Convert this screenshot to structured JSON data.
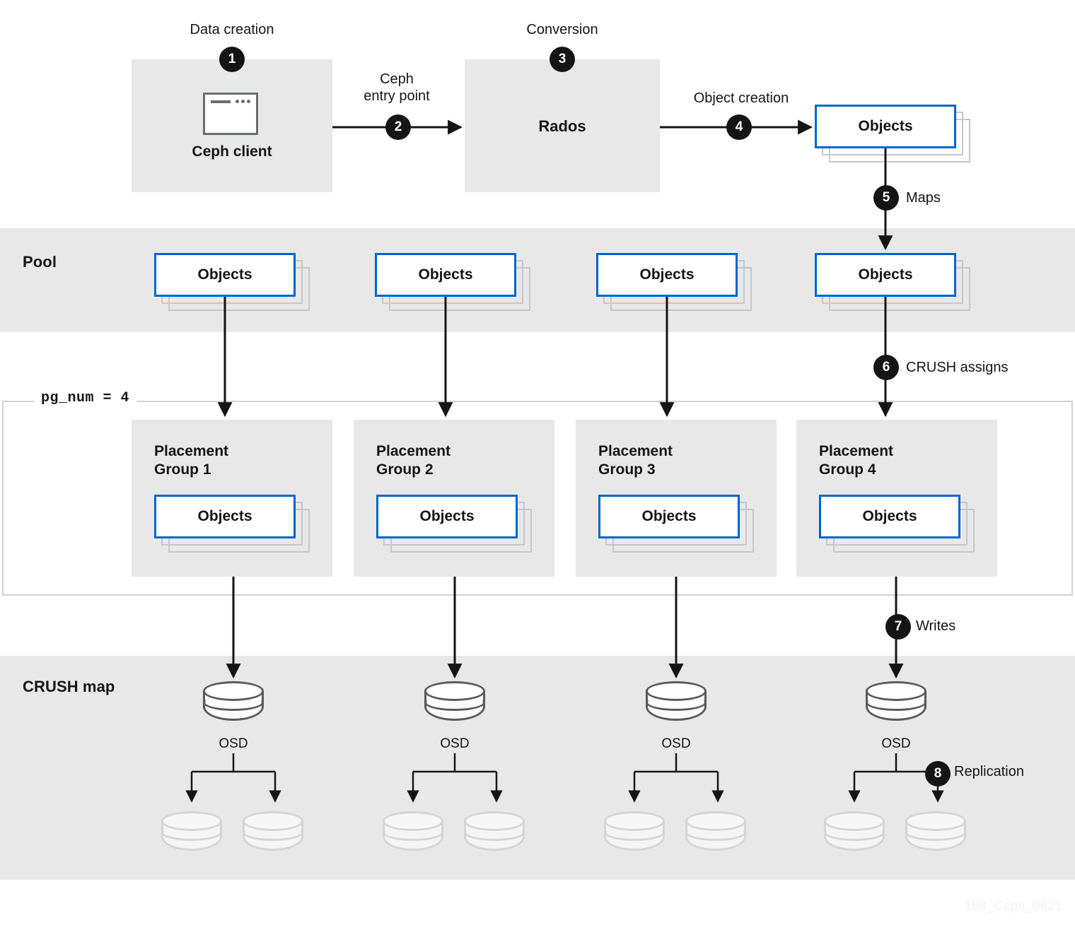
{
  "diagram": {
    "title": "Ceph data placement flow",
    "watermark": "158_Ceph_0621",
    "accent_blue": "#0066cc",
    "band_gray": "#e8e8e8",
    "badge_color": "#151515"
  },
  "bands": {
    "pool": {
      "label": "Pool"
    },
    "crush": {
      "label": "CRUSH map"
    }
  },
  "stages": {
    "data_creation": {
      "caption": "Data creation",
      "badge": "1"
    },
    "ceph_client": {
      "label": "Ceph client",
      "icon": "window-icon"
    },
    "entry_point": {
      "caption": "Ceph\nentry point",
      "badge": "2"
    },
    "conversion": {
      "caption": "Conversion",
      "badge": "3"
    },
    "rados": {
      "label": "Rados"
    },
    "object_creation": {
      "caption": "Object creation",
      "badge": "4"
    }
  },
  "steps": [
    {
      "badge": "1",
      "label": "Data creation"
    },
    {
      "badge": "2",
      "label": "Ceph entry point"
    },
    {
      "badge": "3",
      "label": "Conversion"
    },
    {
      "badge": "4",
      "label": "Object creation"
    },
    {
      "badge": "5",
      "label": "Maps"
    },
    {
      "badge": "6",
      "label": "CRUSH assigns"
    },
    {
      "badge": "7",
      "label": "Writes"
    },
    {
      "badge": "8",
      "label": "Replication"
    }
  ],
  "badge_labels": {
    "maps": "Maps",
    "crush_assigns": "CRUSH assigns",
    "writes": "Writes",
    "replication": "Replication"
  },
  "objects_card_label": "Objects",
  "objects_cards": {
    "created": "Objects",
    "pool": [
      "Objects",
      "Objects",
      "Objects",
      "Objects"
    ],
    "placement_groups": [
      "Objects",
      "Objects",
      "Objects",
      "Objects"
    ]
  },
  "pg_num": {
    "legend": "pg_num = 4",
    "value": 4
  },
  "placement_groups": [
    {
      "title": "Placement\nGroup 1",
      "objects_label": "Objects"
    },
    {
      "title": "Placement\nGroup 2",
      "objects_label": "Objects"
    },
    {
      "title": "Placement\nGroup 3",
      "objects_label": "Objects"
    },
    {
      "title": "Placement\nGroup 4",
      "objects_label": "Objects"
    }
  ],
  "osds": [
    {
      "label": "OSD",
      "replicas": 2
    },
    {
      "label": "OSD",
      "replicas": 2
    },
    {
      "label": "OSD",
      "replicas": 2
    },
    {
      "label": "OSD",
      "replicas": 2
    }
  ]
}
